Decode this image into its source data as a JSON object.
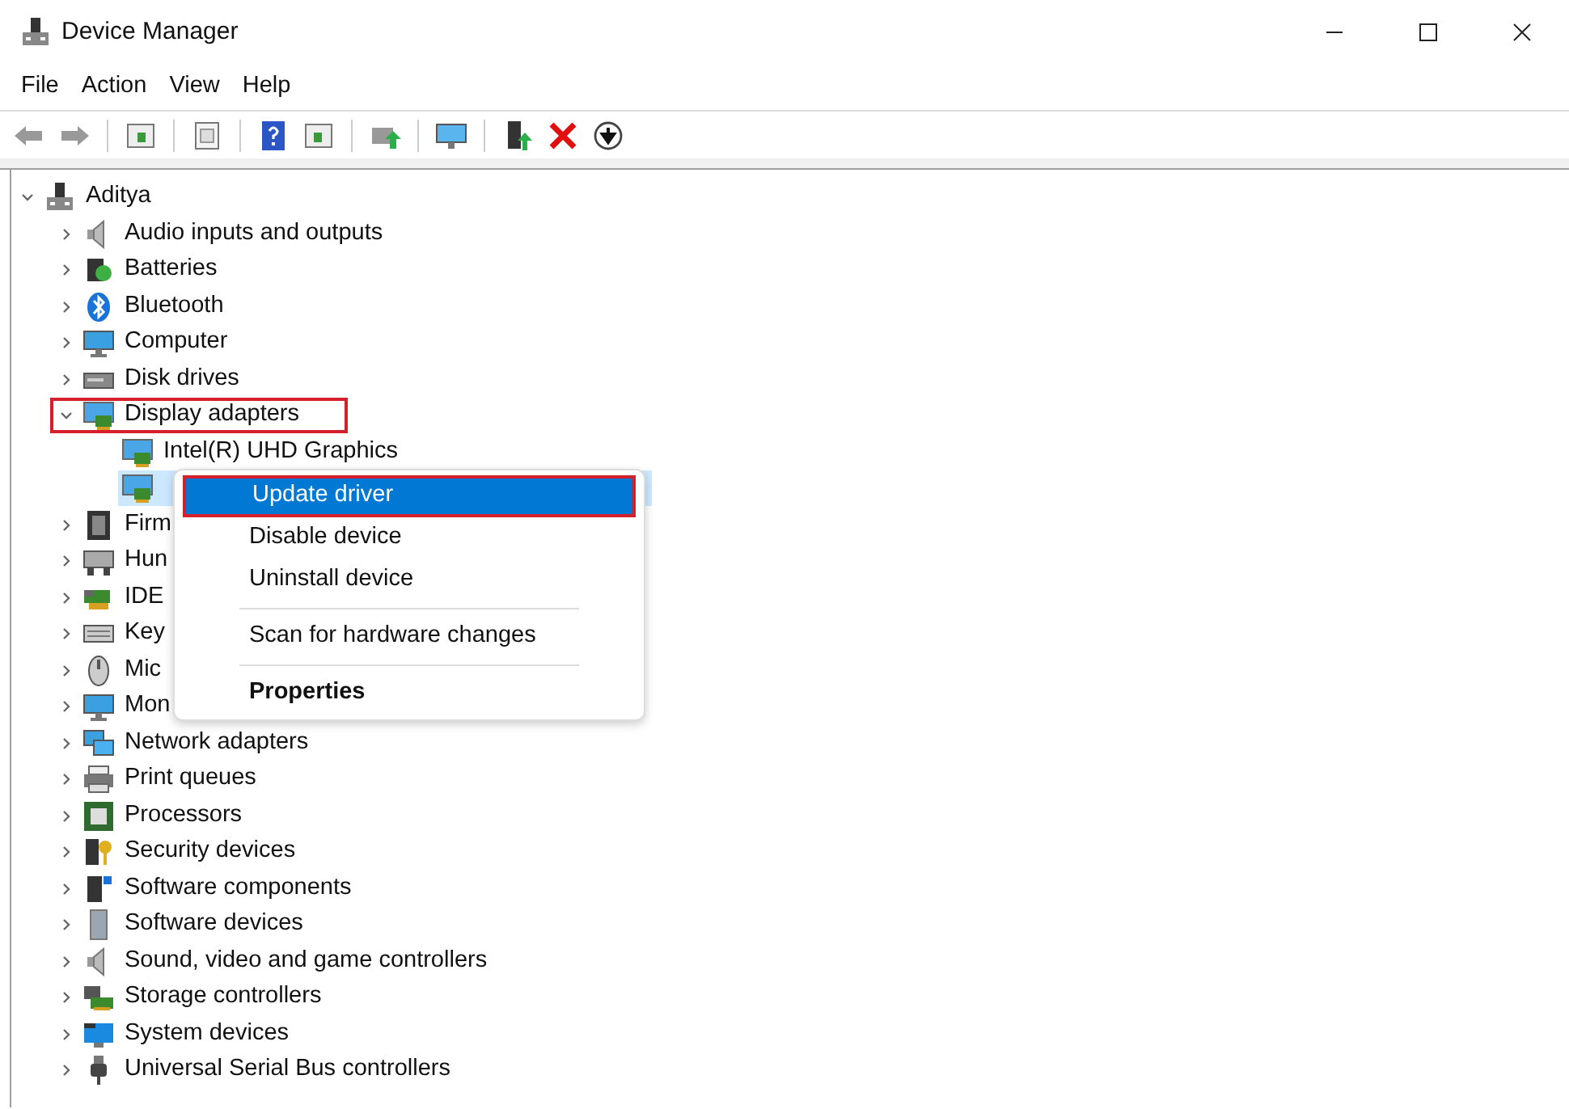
{
  "window": {
    "title": "Device Manager"
  },
  "menu_bar": [
    "File",
    "Action",
    "View",
    "Help"
  ],
  "tree": {
    "label": "Aditya",
    "expanded": true,
    "selected": false,
    "children": [
      {
        "label": "Audio inputs and outputs",
        "expanded": false,
        "selected": false,
        "annotated": false
      },
      {
        "label": "Batteries",
        "expanded": false,
        "selected": false,
        "annotated": false
      },
      {
        "label": "Bluetooth",
        "expanded": false,
        "selected": false,
        "annotated": false
      },
      {
        "label": "Computer",
        "expanded": false,
        "selected": false,
        "annotated": false
      },
      {
        "label": "Disk drives",
        "expanded": false,
        "selected": false,
        "annotated": false
      },
      {
        "label": "Display adapters",
        "expanded": true,
        "selected": false,
        "annotated": true,
        "children": [
          {
            "label": "Intel(R) UHD Graphics",
            "selected": false
          },
          {
            "selected": true
          }
        ]
      },
      {
        "label": "Firm",
        "expanded": false,
        "selected": false,
        "annotated": false
      },
      {
        "label": "Hun",
        "expanded": false,
        "selected": false,
        "annotated": false
      },
      {
        "label": "IDE",
        "expanded": false,
        "selected": false,
        "annotated": false
      },
      {
        "label": "Key",
        "expanded": false,
        "selected": false,
        "annotated": false
      },
      {
        "label": "Mic",
        "expanded": false,
        "selected": false,
        "annotated": false
      },
      {
        "label": "Mon",
        "expanded": false,
        "selected": false,
        "annotated": false
      },
      {
        "label": "Network adapters",
        "expanded": false,
        "selected": false,
        "annotated": false
      },
      {
        "label": "Print queues",
        "expanded": false,
        "selected": false,
        "annotated": false
      },
      {
        "label": "Processors",
        "expanded": false,
        "selected": false,
        "annotated": false
      },
      {
        "label": "Security devices",
        "expanded": false,
        "selected": false,
        "annotated": false
      },
      {
        "label": "Software components",
        "expanded": false,
        "selected": false,
        "annotated": false
      },
      {
        "label": "Software devices",
        "expanded": false,
        "selected": false,
        "annotated": false
      },
      {
        "label": "Sound, video and game controllers",
        "expanded": false,
        "selected": false,
        "annotated": false
      },
      {
        "label": "Storage controllers",
        "expanded": false,
        "selected": false,
        "annotated": false
      },
      {
        "label": "System devices",
        "expanded": false,
        "selected": false,
        "annotated": false
      },
      {
        "label": "Universal Serial Bus controllers",
        "expanded": false,
        "selected": false,
        "annotated": false
      }
    ]
  },
  "context_menu": {
    "items": [
      {
        "kind": "item",
        "label": "Update driver",
        "selected": true,
        "annotated": true
      },
      {
        "kind": "item",
        "label": "Disable device",
        "selected": false,
        "annotated": false
      },
      {
        "kind": "item",
        "label": "Uninstall device",
        "selected": false,
        "annotated": false
      },
      {
        "kind": "separator"
      },
      {
        "kind": "item",
        "label": "Scan for hardware changes",
        "selected": false,
        "annotated": false
      },
      {
        "kind": "separator"
      },
      {
        "kind": "bold",
        "label": "Properties",
        "selected": false,
        "annotated": false
      }
    ]
  }
}
